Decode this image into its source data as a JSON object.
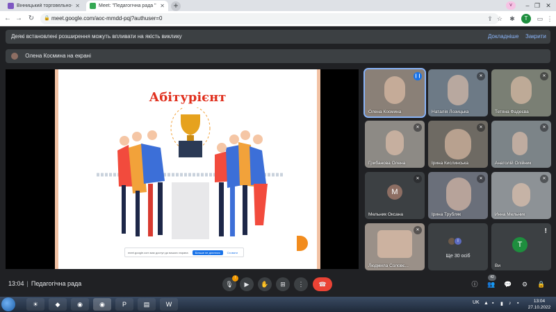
{
  "browser": {
    "tabs": [
      {
        "title": "Вінницький торговельно-економ",
        "active": false,
        "favicon_color": "#7e57c2"
      },
      {
        "title": "Meet: \"Педагогічна рада \"",
        "active": true,
        "favicon_color": "#34a853"
      }
    ],
    "new_tab_label": "+",
    "profile_badge": "v",
    "url": "meet.google.com/aoc-mmdd-pqj?authuser=0",
    "avatar_letter": "T"
  },
  "banners": {
    "extension_warning": "Деякі встановлені розширення можуть впливати на якість виклику",
    "learn_more": "Докладніше",
    "close": "Закрити",
    "presenting": "Олена Космина на екрані"
  },
  "slide": {
    "title": "Абітурієнт",
    "bar_text": "meet.google.com має доступ до вашого екрана",
    "bar_button": "Більше не ділитися",
    "bar_link": "Сховати"
  },
  "participants": [
    {
      "name": "Олена Космина",
      "mic": "active",
      "bg": "#8a8077"
    },
    {
      "name": "Наталія Лозицька",
      "mic": "muted",
      "bg": "#6d7a86"
    },
    {
      "name": "Тетяна Фадеєва",
      "mic": "muted",
      "bg": "#7a7f74"
    },
    {
      "name": "Грибанова Олена",
      "mic": "muted",
      "bg": "#8d8a85"
    },
    {
      "name": "Ірина Кислинська",
      "mic": "muted",
      "bg": "#6e6a63"
    },
    {
      "name": "Анатолій Олійник",
      "mic": "muted",
      "bg": "#7c8488"
    },
    {
      "name": "Мельник Оксана",
      "mic": "muted",
      "bg": "#3c4043",
      "avatar_letter": "М",
      "avatar_color": "#8d6e63"
    },
    {
      "name": "Ірина Трубляк",
      "mic": "muted",
      "bg": "#6a6f7a"
    },
    {
      "name": "Инна Мельник",
      "mic": "muted",
      "bg": "#8d9296"
    },
    {
      "name": "Людмила Соловє...",
      "mic": "muted",
      "bg": "#9a9088"
    },
    {
      "name": "",
      "more_label": "Ще 30 осіб",
      "mini_letter": "І",
      "bg": "#3c4043"
    },
    {
      "name": "Ви",
      "avatar_letter": "T",
      "avatar_color": "#1e8e3e",
      "warning": "!",
      "bg": "#3c4043"
    }
  ],
  "controls": {
    "time": "13:04",
    "meeting_name": "Педагогічна рада",
    "mic_badge": "!",
    "people_count": "42"
  },
  "taskbar": {
    "lang": "UK",
    "time": "13:04",
    "date": "27.10.2022"
  }
}
